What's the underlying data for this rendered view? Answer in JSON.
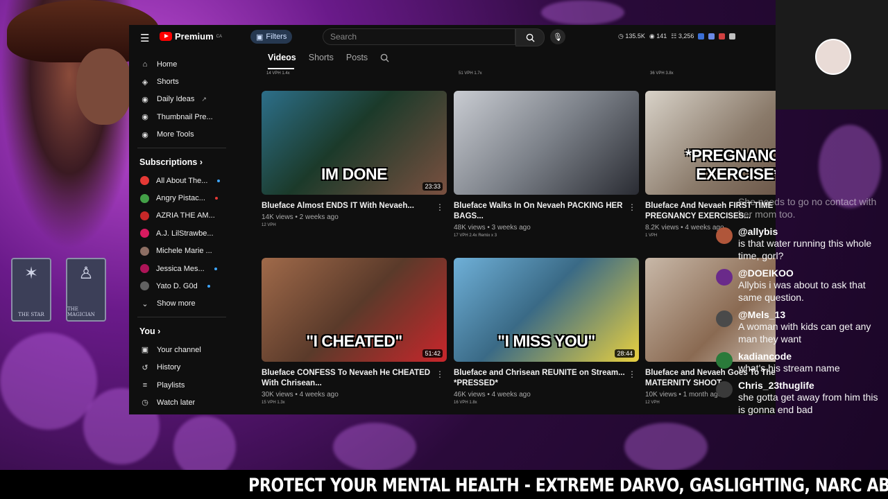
{
  "topbar": {
    "brand": "Premium",
    "region": "CA",
    "filters_label": "Filters",
    "search_placeholder": "Search",
    "stats": {
      "views": "135.5K",
      "likes": "141",
      "subs": "3,256"
    }
  },
  "sidebar": {
    "main": [
      {
        "label": "Home",
        "icon": "home-icon"
      },
      {
        "label": "Shorts",
        "icon": "shorts-icon"
      },
      {
        "label": "Daily Ideas",
        "icon": "ideas-icon"
      },
      {
        "label": "Thumbnail Pre...",
        "icon": "thumbnail-icon"
      },
      {
        "label": "More Tools",
        "icon": "tools-icon"
      }
    ],
    "subs_title": "Subscriptions",
    "subs": [
      {
        "label": "All About The...",
        "color": "#e53935"
      },
      {
        "label": "Angry Pistac...",
        "color": "#43a047"
      },
      {
        "label": "AZRIA THE AM...",
        "color": "#c62828"
      },
      {
        "label": "A.J. LilStrawbe...",
        "color": "#d81b60"
      },
      {
        "label": "Michele Marie ...",
        "color": "#8d6e63"
      },
      {
        "label": "Jessica Mes...",
        "color": "#ad1457"
      },
      {
        "label": "Yato D. G0d",
        "color": "#616161"
      }
    ],
    "show_more": "Show more",
    "you_title": "You",
    "you": [
      {
        "label": "Your channel",
        "icon": "channel-icon"
      },
      {
        "label": "History",
        "icon": "history-icon"
      },
      {
        "label": "Playlists",
        "icon": "playlists-icon"
      },
      {
        "label": "Watch later",
        "icon": "watch-later-icon"
      }
    ]
  },
  "tabs": [
    "Videos",
    "Shorts",
    "Posts"
  ],
  "prev_row_badges": [
    "14 VPH 1.4x",
    "51 VPH 1.7x",
    "36 VPH 3.8x"
  ],
  "videos": [
    {
      "caption": "IM DONE",
      "duration": "23:33",
      "title": "Blueface Almost ENDS IT With Nevaeh...",
      "meta": "14K views • 2 weeks ago",
      "badge": "12 VPH",
      "bg": "linear-gradient(135deg,#2d6f8a,#1b3a2a 45%,#7a5040)"
    },
    {
      "caption": "",
      "duration": "",
      "title": "Blueface Walks In On Nevaeh PACKING HER BAGS...",
      "meta": "48K views • 3 weeks ago",
      "badge": "17 VPH 2.4x Remix x 3",
      "bg": "linear-gradient(135deg,#c9ccd2,#7b8088 50%,#2a2c33)"
    },
    {
      "caption": "*PREGNANCY EXERCISE*",
      "duration": "16:29",
      "title": "Blueface And Nevaeh FIRST TIME Doing PREGNANCY EXERCISES...",
      "meta": "8.2K views • 4 weeks ago",
      "badge": "1 VPH",
      "bg": "linear-gradient(135deg,#d8d2c8,#8a7a6a 50%,#5b4436)"
    },
    {
      "caption": "\"I CHEATED\"",
      "duration": "51:42",
      "title": "Blueface CONFESS To Nevaeh He CHEATED With Chrisean...",
      "meta": "30K views • 4 weeks ago",
      "badge": "15 VPH 1.3x",
      "bg": "linear-gradient(135deg,#a06a4a,#5a3a2a 50%,#c8262b)"
    },
    {
      "caption": "\"I MISS YOU\"",
      "duration": "28:44",
      "title": "Blueface and Chrisean REUNITE on Stream... *PRESSED*",
      "meta": "46K views • 4 weeks ago",
      "badge": "16 VPH 1.8x",
      "bg": "linear-gradient(135deg,#6fb0d8,#3a6a86 45%,#e8d040)"
    },
    {
      "caption": "",
      "duration": "",
      "title": "Blueface and Nevaeh Goes To Their MATERNITY SHOOT...",
      "meta": "10K views • 1 month ago",
      "badge": "12 VPH",
      "bg": "linear-gradient(135deg,#c8b8a8,#8a6a52 50%,#f0ece6)"
    }
  ],
  "chat": [
    {
      "user": "",
      "text": "She needs to go no contact with her mom too.",
      "faded": true,
      "color": "#555"
    },
    {
      "user": "@allybis",
      "text": "is that water running this whole time, gorl?",
      "faded": false,
      "color": "#b0563a"
    },
    {
      "user": "@DOEIKOO",
      "text": "Allybis i was about to ask that same question.",
      "faded": false,
      "color": "#6a2a8a"
    },
    {
      "user": "@Mels_13",
      "text": "A woman with kids can get any man they want",
      "faded": false,
      "color": "#4a4a4a"
    },
    {
      "user": "kadiancode",
      "text": "what's his stream name",
      "faded": false,
      "color": "#2a7a3a"
    },
    {
      "user": "Chris_23thuglife",
      "text": "she gotta get away from him this is gonna end bad",
      "faded": false,
      "color": "#3a3a3a"
    }
  ],
  "tarot": [
    {
      "name": "THE STAR",
      "glyph": "✶"
    },
    {
      "name": "THE MAGICIAN",
      "glyph": "♙"
    }
  ],
  "ticker": "PROTECT YOUR MENTAL HEALTH - EXTREME DARVO, GASLIGHTING, NARC ABUSE, POWER I"
}
